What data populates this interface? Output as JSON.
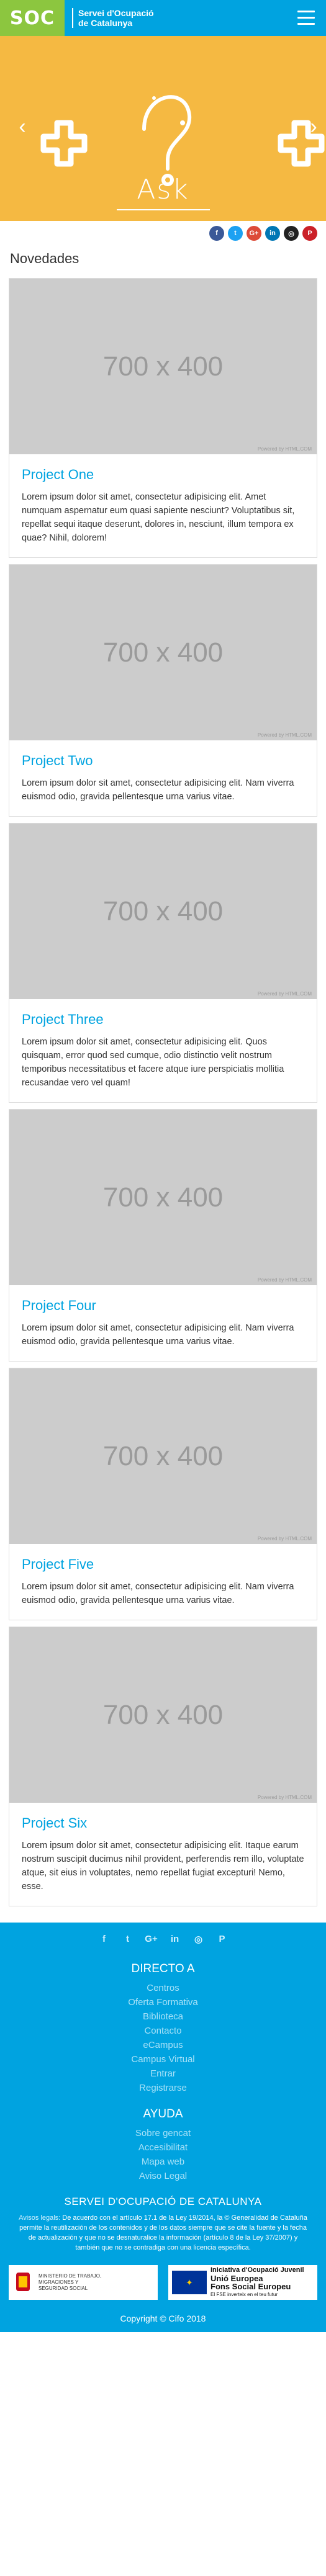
{
  "header": {
    "logo": "SOC",
    "subtitle_line1": "Servei d'Ocupació",
    "subtitle_line2": "de Catalunya",
    "menu_icon": "hamburger-icon"
  },
  "hero": {
    "word": "Ask",
    "prev_icon": "chevron-left-icon",
    "next_icon": "chevron-right-icon"
  },
  "share": [
    {
      "label": "f",
      "icon": "facebook-icon",
      "color": "#3b5998"
    },
    {
      "label": "t",
      "icon": "twitter-icon",
      "color": "#1da1f2"
    },
    {
      "label": "G+",
      "icon": "google-plus-icon",
      "color": "#dd4b39"
    },
    {
      "label": "in",
      "icon": "linkedin-icon",
      "color": "#0077b5"
    },
    {
      "label": "◎",
      "icon": "instagram-icon",
      "color": "#222222"
    },
    {
      "label": "P",
      "icon": "pinterest-icon",
      "color": "#cb2027"
    }
  ],
  "section": {
    "title": "Novedades"
  },
  "placeholder": {
    "text": "700 x 400",
    "credit": "Powered by HTML.COM"
  },
  "projects": [
    {
      "title": "Project One",
      "text": "Lorem ipsum dolor sit amet, consectetur adipisicing elit. Amet numquam aspernatur eum quasi sapiente nesciunt? Voluptatibus sit, repellat sequi itaque deserunt, dolores in, nesciunt, illum tempora ex quae? Nihil, dolorem!"
    },
    {
      "title": "Project Two",
      "text": "Lorem ipsum dolor sit amet, consectetur adipisicing elit. Nam viverra euismod odio, gravida pellentesque urna varius vitae."
    },
    {
      "title": "Project Three",
      "text": "Lorem ipsum dolor sit amet, consectetur adipisicing elit. Quos quisquam, error quod sed cumque, odio distinctio velit nostrum temporibus necessitatibus et facere atque iure perspiciatis mollitia recusandae vero vel quam!"
    },
    {
      "title": "Project Four",
      "text": "Lorem ipsum dolor sit amet, consectetur adipisicing elit. Nam viverra euismod odio, gravida pellentesque urna varius vitae."
    },
    {
      "title": "Project Five",
      "text": "Lorem ipsum dolor sit amet, consectetur adipisicing elit. Nam viverra euismod odio, gravida pellentesque urna varius vitae."
    },
    {
      "title": "Project Six",
      "text": "Lorem ipsum dolor sit amet, consectetur adipisicing elit. Itaque earum nostrum suscipit ducimus nihil provident, perferendis rem illo, voluptate atque, sit eius in voluptates, nemo repellat fugiat excepturi! Nemo, esse."
    }
  ],
  "footer": {
    "social": [
      {
        "label": "f",
        "icon": "facebook-icon"
      },
      {
        "label": "t",
        "icon": "twitter-icon"
      },
      {
        "label": "G+",
        "icon": "google-plus-icon"
      },
      {
        "label": "in",
        "icon": "linkedin-icon"
      },
      {
        "label": "◎",
        "icon": "instagram-icon"
      },
      {
        "label": "P",
        "icon": "pinterest-icon"
      }
    ],
    "direct_title": "DIRECTO A",
    "direct_links": [
      "Centros",
      "Oferta Formativa",
      "Biblioteca",
      "Contacto",
      "eCampus",
      "Campus Virtual",
      "Entrar",
      "Registrarse"
    ],
    "help_title": "AYUDA",
    "help_links": [
      "Sobre gencat",
      "Accesibilitat",
      "Mapa web",
      "Aviso Legal"
    ],
    "org_title": "SERVEI D'OCUPACIÓ DE CATALUNYA",
    "legal_label": "Avisos legals:",
    "legal_text": "De acuerdo con el artículo 17.1 de la Ley 19/2014, la © Generalidad de Cataluña permite la reutilización de los contenidos y de los datos siempre que se cite la fuente y la fecha de actualización y que no se desnaturalice la información (artículo 8 de la Ley 37/2007) y también que no se contradiga con una licencia específica.",
    "ministry_text": "MINISTERIO DE TRABAJO, MIGRACIONES Y SEGURIDAD SOCIAL",
    "eu_line1": "Iniciativa d'Ocupació Juvenil",
    "eu_line2": "Unió Europea",
    "eu_line3": "Fons Social Europeu",
    "eu_line4": "El FSE inverteix en el teu futur",
    "copyright": "Copyright © Cifo 2018"
  }
}
